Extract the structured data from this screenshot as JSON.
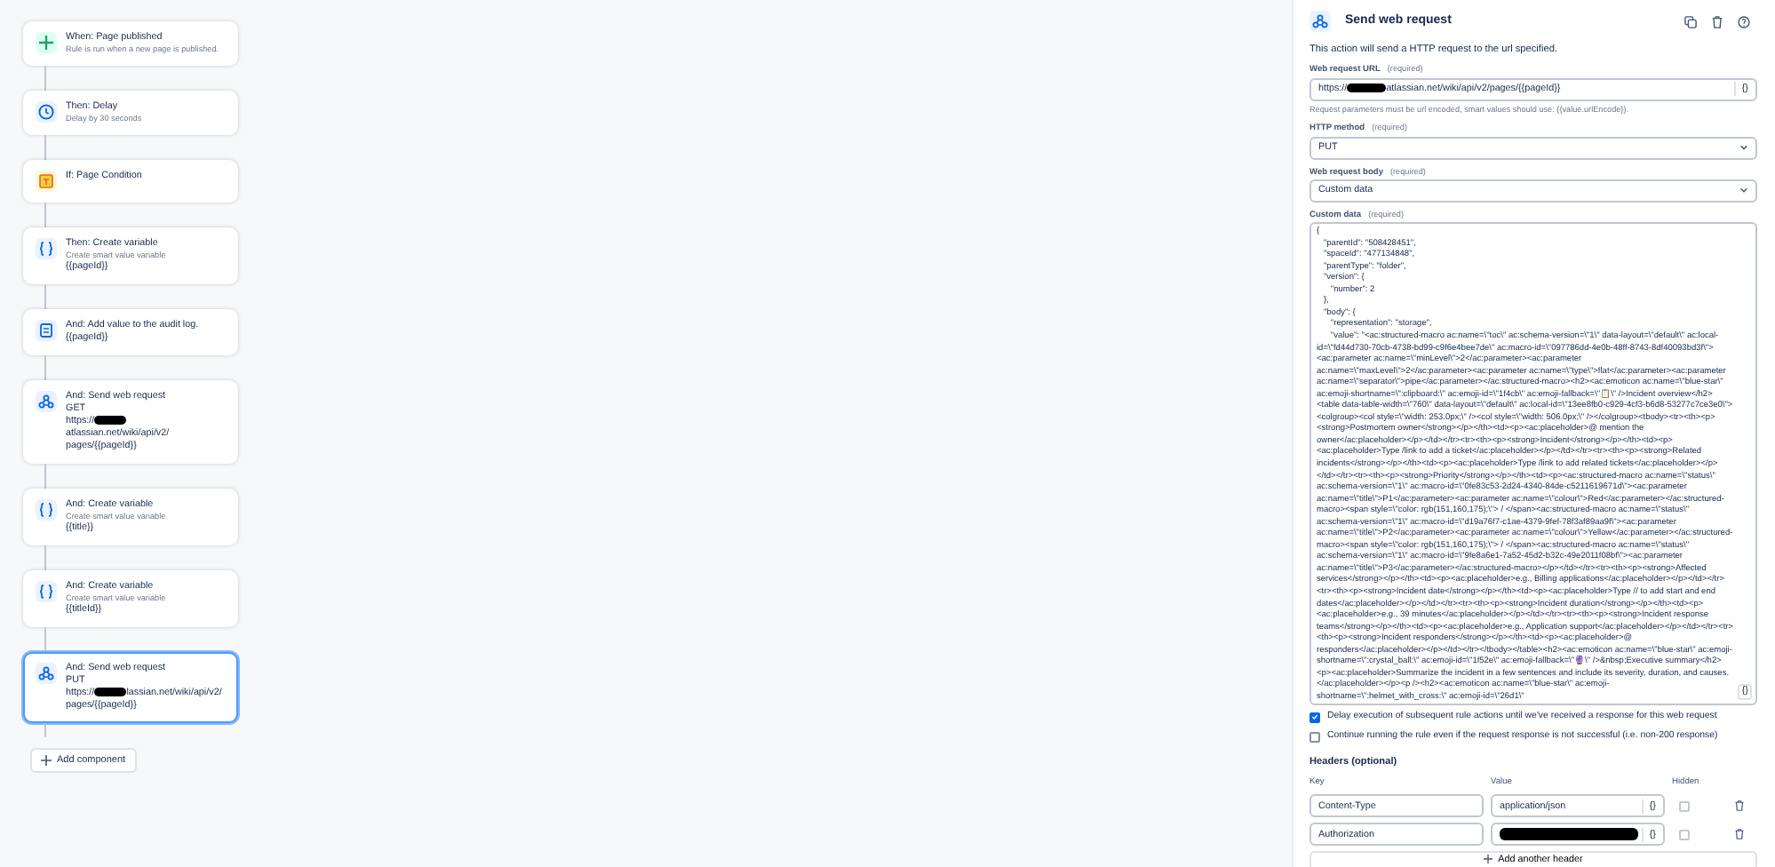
{
  "rule_steps": [
    {
      "kind": "trigger",
      "title": "When: Page published",
      "subtitle": "Rule is run when a new page is published.",
      "selected": false
    },
    {
      "kind": "delay",
      "title": "Then: Delay",
      "subtitle": "Delay by 30 seconds",
      "selected": false
    },
    {
      "kind": "condition",
      "title": "If: Page Condition",
      "selected": false
    },
    {
      "kind": "variable",
      "title": "Then: Create variable",
      "subtitle": "Create smart value variable",
      "lines": [
        {
          "text": "{{pageId}}"
        }
      ],
      "selected": false
    },
    {
      "kind": "log",
      "title": "And: Add value to the audit log.",
      "lines": [
        {
          "text": "{{pageId}}"
        }
      ],
      "selected": false
    },
    {
      "kind": "webhook",
      "title": "And: Send web request",
      "lines": [
        {
          "text": "GET"
        },
        {
          "url_prefix": "https://",
          "url_suffix": "atlassian.net/wiki/api/v2/",
          "redacted": true
        },
        {
          "text": "pages/{{pageId}}"
        }
      ],
      "selected": false
    },
    {
      "kind": "variable",
      "title": "And: Create variable",
      "subtitle": "Create smart value variable",
      "lines": [
        {
          "text": "{{title}}"
        }
      ],
      "selected": false
    },
    {
      "kind": "variable",
      "title": "And: Create variable",
      "subtitle": "Create smart value variable",
      "lines": [
        {
          "text": "{{titleId}}"
        }
      ],
      "selected": false
    },
    {
      "kind": "webhook",
      "title": "And: Send web request",
      "lines": [
        {
          "text": "PUT"
        },
        {
          "url_prefix": "https://",
          "url_suffix": "lassian.net/wiki/api/v2/",
          "redacted": true
        },
        {
          "text": "pages/{{pageId}}"
        }
      ],
      "selected": true
    }
  ],
  "add_component": "Add component",
  "panel": {
    "title": "Send web request",
    "description": "This action will send a HTTP request to the url specified.",
    "url_field": {
      "label": "Web request URL",
      "required": "(required)",
      "prefix": "https://",
      "suffix": "atlassian.net/wiki/api/v2/pages/{{pageId}}",
      "redacted": true,
      "button": "{}",
      "hint": "Request parameters must be url encoded, smart values should use: {{value.urlEncode}}."
    },
    "method_field": {
      "label": "HTTP method",
      "required": "(required)",
      "value": "PUT"
    },
    "body_field": {
      "label": "Web request body",
      "required": "(required)",
      "value": "Custom data"
    },
    "custom_data": {
      "label": "Custom data",
      "required": "(required)",
      "button": "{}",
      "value": "{\n   \"parentId\": \"508428451\",\n   \"spaceId\": \"477134848\",\n   \"parentType\": \"folder\",\n   \"version\": {\n      \"number\": 2\n   },\n   \"body\": {\n      \"representation\": \"storage\",\n      \"value\": \"<ac:structured-macro ac:name=\\\"toc\\\" ac:schema-version=\\\"1\\\" data-layout=\\\"default\\\" ac:local-id=\\\"fd44d730-70cb-4738-bd99-c9f6e4bee7de\\\" ac:macro-id=\\\"097786dd-4e0b-48ff-8743-8df40093bd3f\\\"><ac:parameter ac:name=\\\"minLevel\\\">2</ac:parameter><ac:parameter ac:name=\\\"maxLevel\\\">2</ac:parameter><ac:parameter ac:name=\\\"type\\\">flat</ac:parameter><ac:parameter ac:name=\\\"separator\\\">pipe</ac:parameter></ac:structured-macro><h2><ac:emoticon ac:name=\\\"blue-star\\\" ac:emoji-shortname=\\\":clipboard:\\\" ac:emoji-id=\\\"1f4cb\\\" ac:emoji-fallback=\\\"📋\\\" />Incident overview</h2><table data-table-width=\\\"760\\\" data-layout=\\\"default\\\" ac:local-id=\\\"13ee8fb0-c929-4cf3-b6d8-53277c7ce3e0\\\"><colgroup><col style=\\\"width: 253.0px;\\\" /><col style=\\\"width: 506.0px;\\\" /></colgroup><tbody><tr><th><p><strong>Postmortem owner</strong></p></th><td><p><ac:placeholder>@ mention the owner</ac:placeholder></p></td></tr><tr><th><p><strong>Incident</strong></p></th><td><p><ac:placeholder>Type /link to add a ticket</ac:placeholder></p></td></tr><tr><th><p><strong>Related incidents</strong></p></th><td><p><ac:placeholder>Type /link to add related tickets</ac:placeholder></p></td></tr><tr><th><p><strong>Priority</strong></p></th><td><p><ac:structured-macro ac:name=\\\"status\\\" ac:schema-version=\\\"1\\\" ac:macro-id=\\\"0fe83c53-2d24-4340-84de-c5211619671d\\\"><ac:parameter ac:name=\\\"title\\\">P1</ac:parameter><ac:parameter ac:name=\\\"colour\\\">Red</ac:parameter></ac:structured-macro><span style=\\\"color: rgb(151,160,175);\\\"> / </span><ac:structured-macro ac:name=\\\"status\\\" ac:schema-version=\\\"1\\\" ac:macro-id=\\\"d19a76f7-c1ae-4379-9fef-78f3af89aa9f\\\"><ac:parameter ac:name=\\\"title\\\">P2</ac:parameter><ac:parameter ac:name=\\\"colour\\\">Yellow</ac:parameter></ac:structured-macro><span style=\\\"color: rgb(151,160,175);\\\"> / </span><ac:structured-macro ac:name=\\\"status\\\" ac:schema-version=\\\"1\\\" ac:macro-id=\\\"9fe8a6e1-7a52-45d2-b32c-49e2011f08bf\\\"><ac:parameter ac:name=\\\"title\\\">P3</ac:parameter></ac:structured-macro></p></td></tr><tr><th><p><strong>Affected services</strong></p></th><td><p><ac:placeholder>e.g., Billing applications</ac:placeholder></p></td></tr><tr><th><p><strong>Incident date</strong></p></th><td><p><ac:placeholder>Type // to add start and end dates</ac:placeholder></p></td></tr><tr><th><p><strong>Incident duration</strong></p></th><td><p><ac:placeholder>e.g., 39 minutes</ac:placeholder></p></td></tr><tr><th><p><strong>Incident response teams</strong></p></th><td><p><ac:placeholder>e.g., Application support</ac:placeholder></p></td></tr><tr><th><p><strong>Incident responders</strong></p></th><td><p><ac:placeholder>@ responders</ac:placeholder></p></td></tr></tbody></table><h2><ac:emoticon ac:name=\\\"blue-star\\\" ac:emoji-shortname=\\\":crystal_ball:\\\" ac:emoji-id=\\\"1f52e\\\" ac:emoji-fallback=\\\"🔮\\\" />&nbsp;Executive summary</h2><p><ac:placeholder>Summarize the incident in a few sentences and include its severity, duration, and causes.</ac:placeholder></p><p /><h2><ac:emoticon ac:name=\\\"blue-star\\\" ac:emoji-shortname=\\\":helmet_with_cross:\\\" ac:emoji-id=\\\"26d1\\\""
    },
    "options": [
      {
        "label": "Delay execution of subsequent rule actions until we've received a response for this web request",
        "checked": true
      },
      {
        "label": "Continue running the rule even if the request response is not successful (i.e. non-200 response)",
        "checked": false
      }
    ],
    "headers": {
      "title": "Headers (optional)",
      "columns": [
        "Key",
        "Value",
        "Hidden"
      ],
      "rows": [
        {
          "key": "Content-Type",
          "value": "application/json",
          "button": "{}",
          "hidden": false
        },
        {
          "key": "Authorization",
          "redacted": true,
          "button": "{}",
          "hidden": false
        }
      ],
      "add_button": "Add another header"
    }
  }
}
